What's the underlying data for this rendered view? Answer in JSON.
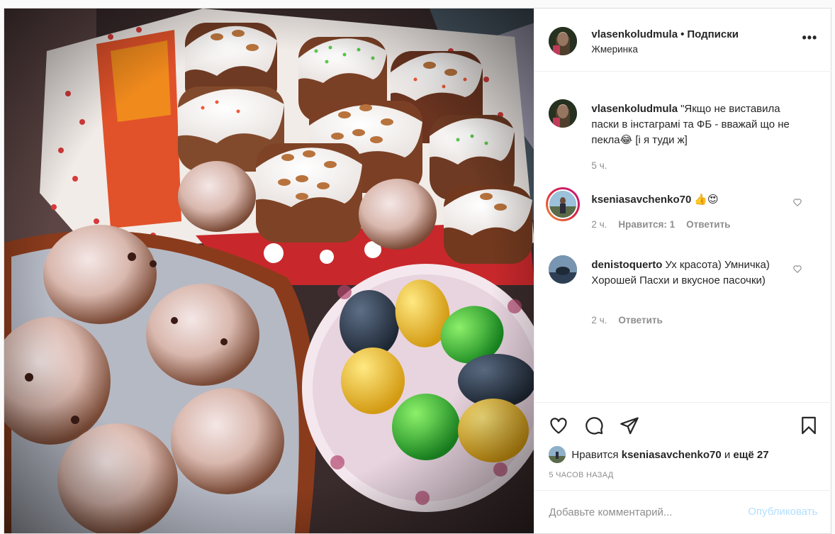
{
  "post": {
    "author": "vlasenkoludmula",
    "separator": "•",
    "follow_label": "Подписки",
    "location": "Жмеринка",
    "more_icon": "more-horizontal-icon",
    "more_label": "•••"
  },
  "caption": {
    "user": "vlasenkoludmula",
    "text": "\"Якщо не виставила паски в інстаграмі та ФБ - вважай що не пекла😂 [і я туди ж]",
    "time": "5 ч."
  },
  "comments": [
    {
      "user": "kseniasavchenko70",
      "text": "👍😍",
      "time": "2 ч.",
      "likes_label": "Нравится: 1",
      "reply_label": "Ответить"
    },
    {
      "user": "denistoquerto",
      "text": "Ух красота) Умничка) Хорошей Пасхи и вкусное пасочки)",
      "time": "2 ч.",
      "reply_label": "Ответить"
    }
  ],
  "actions": {
    "like_icon": "heart-icon",
    "comment_icon": "comment-icon",
    "share_icon": "send-icon",
    "save_icon": "bookmark-icon"
  },
  "likes": {
    "prefix": "Нравится",
    "user": "kseniasavchenko70",
    "joiner": "и",
    "others": "ещё 27"
  },
  "timestamp": "5 ЧАСОВ НАЗАД",
  "add_comment": {
    "placeholder": "Добавьте комментарий...",
    "publish_label": "Опубликовать"
  },
  "colors": {
    "border": "#dbdbdb",
    "muted": "#8e8e8e",
    "publish_disabled": "#b2dffc"
  }
}
